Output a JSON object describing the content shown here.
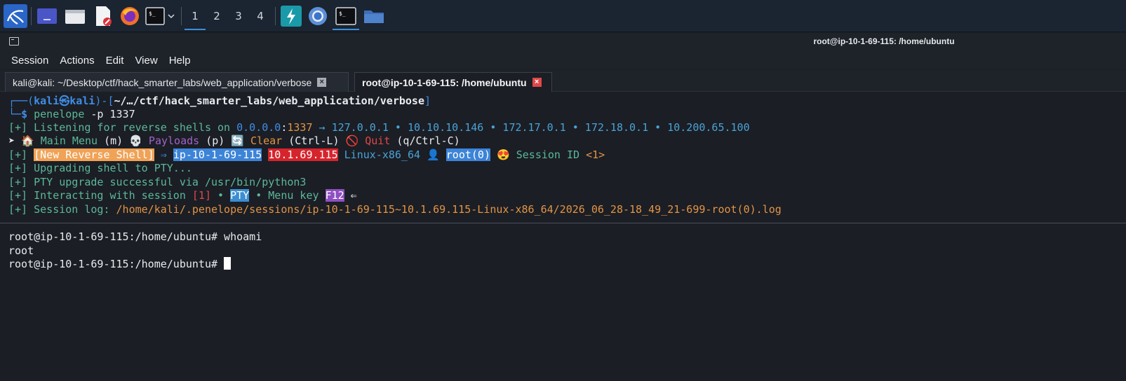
{
  "taskbar": {
    "workspaces": [
      "1",
      "2",
      "3",
      "4"
    ],
    "active_workspace": "1",
    "apps": [
      "kali-menu-icon",
      "desktop-icon",
      "file-manager-icon",
      "text-editor-icon",
      "firefox-icon",
      "terminal-icon",
      "burpsuite-icon",
      "chromium-icon",
      "terminal-icon",
      "folder-icon"
    ]
  },
  "window": {
    "title": "root@ip-10-1-69-115: /home/ubuntu"
  },
  "menubar": {
    "items": [
      "Session",
      "Actions",
      "Edit",
      "View",
      "Help"
    ]
  },
  "tabs": [
    {
      "label": "kali@kali: ~/Desktop/ctf/hack_smarter_labs/web_application/verbose",
      "active": false
    },
    {
      "label": "root@ip-10-1-69-115: /home/ubuntu",
      "active": true
    }
  ],
  "terminal": {
    "prompt_user": "kali",
    "prompt_skull": "㉿",
    "prompt_host": "kali",
    "prompt_path": "~/…/ctf/hack_smarter_labs/web_application/verbose",
    "command": "penelope",
    "command_args": " -p 1337",
    "l3_prefix": "[+] Listening for reverse shells on ",
    "l3_ip": "0.0.0.0",
    "l3_colon": ":",
    "l3_port": "1337",
    "l3_arrow": " → ",
    "l3_addrs": "127.0.0.1 • 10.10.10.146 • 172.17.0.1 • 172.18.0.1 • 10.200.65.100",
    "l4_bullet": "➤ ",
    "l4_home_icon": "🏠",
    "l4_main": " Main Menu",
    "l4_main_key": " (m) ",
    "l4_skull_icon": "💀",
    "l4_payloads": " Payloads",
    "l4_payloads_key": " (p) ",
    "l4_clear_icon": "🔄",
    "l4_clear": " Clear",
    "l4_clear_key": " (Ctrl-L) ",
    "l4_quit_icon": "🚫",
    "l4_quit": " Quit",
    "l4_quit_key": " (q/Ctrl-C)",
    "l5_prefix": "[+] ",
    "l5_badge": "[New Reverse Shell]",
    "l5_arrow": " ⇒ ",
    "l5_host": "ip-10-1-69-115",
    "l5_ip": "10.1.69.115",
    "l5_os": " Linux-x86_64 ",
    "l5_user_icon": "👤",
    "l5_user": "root(0)",
    "l5_face_icon": "😍",
    "l5_session": " Session ID ",
    "l5_session_id": "<1>",
    "l6": "[+] Upgrading shell to PTY...",
    "l7": "[+] PTY upgrade successful via /usr/bin/python3",
    "l8_prefix": "[+] Interacting with session ",
    "l8_id": "[1]",
    "l8_mid": " • ",
    "l8_pty": "PTY",
    "l8_mid2": " • Menu key ",
    "l8_key": "F12",
    "l8_arrow": " ⇐",
    "l9_prefix": "[+] Session log: ",
    "l9_path": "/home/kali/.penelope/sessions/ip-10-1-69-115~10.1.69.115-Linux-x86_64/2026_06_28-18_49_21-699-root(0).log",
    "shell_prompt": "root@ip-10-1-69-115:/home/ubuntu# ",
    "shell_cmd": "whoami",
    "shell_output": "root"
  }
}
